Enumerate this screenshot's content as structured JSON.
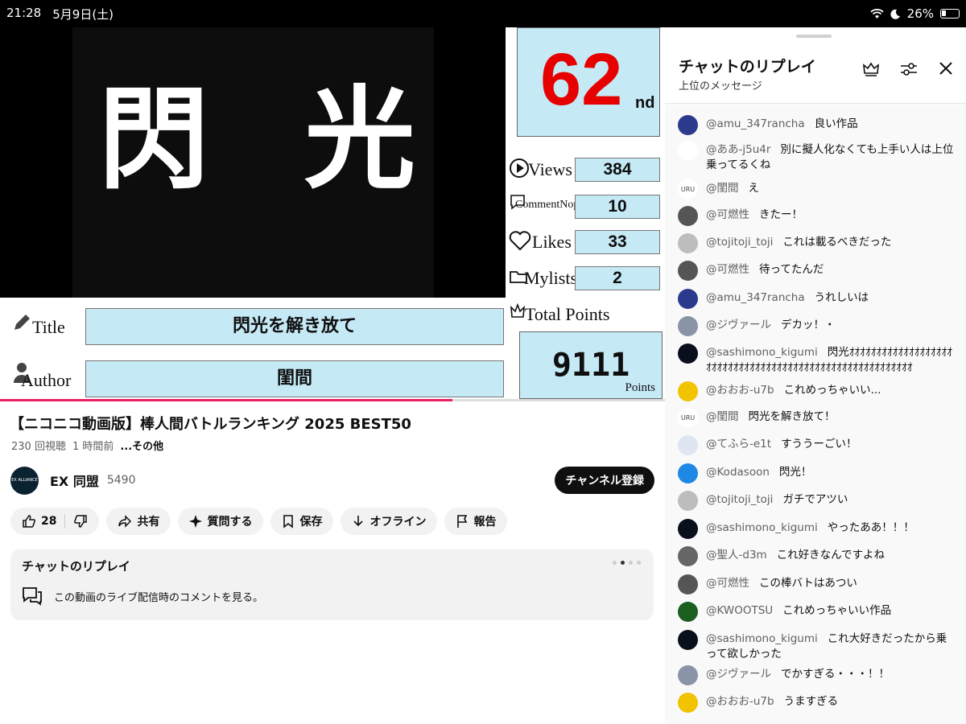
{
  "status_bar": {
    "time": "21:28",
    "date": "5月9日(土)",
    "battery": "26%"
  },
  "video": {
    "kanji_left": "閃",
    "kanji_right": "光",
    "rank_number": "62",
    "rank_suffix": "nd",
    "stats": [
      {
        "label": "Views",
        "value": "384"
      },
      {
        "label": "CommentNop",
        "value": "10"
      },
      {
        "label": "Likes",
        "value": "33"
      },
      {
        "label": "Mylists",
        "value": "2"
      }
    ],
    "total_label": "Total Points",
    "total_value": "9111",
    "total_unit": "Points",
    "title_label": "Title",
    "title_value": "閃光を解き放て",
    "author_label": "Author",
    "author_value": "閨間",
    "progress_fraction": 0.68
  },
  "info": {
    "title": "【ニコニコ動画版】棒人間バトルランキング 2025 BEST50",
    "views": "230 回視聴",
    "age": "1 時間前",
    "more": "...その他",
    "channel_name": "EX 同盟",
    "channel_subs": "5490",
    "avatar_text": "EX ALLIANCE",
    "subscribe": "チャンネル登録",
    "like_count": "28",
    "share": "共有",
    "ask": "質問する",
    "save": "保存",
    "offline": "オフライン",
    "report": "報告",
    "replay_title": "チャットのリプレイ",
    "replay_desc": "この動画のライブ配信時のコメントを見る。"
  },
  "chat": {
    "title": "チャットのリプレイ",
    "subtitle": "上位のメッセージ",
    "messages": [
      {
        "user": "@amu_347rancha",
        "text": "良い作品",
        "avatar_color": "#2b3a8c"
      },
      {
        "user": "@ああ-j5u4r",
        "text": "別に擬人化なくても上手い人は上位乗ってるくね",
        "avatar_color": "#ffffff"
      },
      {
        "user": "@閨間",
        "text": "え",
        "avatar_color": "#ffffff",
        "avatar_text": "URU"
      },
      {
        "user": "@可燃性",
        "text": "きたー！",
        "avatar_color": "#555555"
      },
      {
        "user": "@tojitoji_toji",
        "text": "これは載るべきだった",
        "avatar_color": "#bdbdbd"
      },
      {
        "user": "@可燃性",
        "text": "待ってたんだ",
        "avatar_color": "#555555"
      },
      {
        "user": "@amu_347rancha",
        "text": "うれしいは",
        "avatar_color": "#2b3a8c"
      },
      {
        "user": "@ジヴァール",
        "text": "デカッ！・",
        "avatar_color": "#8a93a8"
      },
      {
        "user": "@sashimono_kigumi",
        "text": "閃光ｵｵｵｵｵｵｵｵｵｵｵｵｵｵｵｵｵｵｵｵｵｵｵｵｵｵｵｵｵｵｵｵｵｵｵｵｵｵｵｵｵｵｵｵｵｵｵｵｵｵｵｵｵｵｵｵｵ",
        "avatar_color": "#0a0f1e"
      },
      {
        "user": "@おおお-u7b",
        "text": "これめっちゃいい...",
        "avatar_color": "#f2c300"
      },
      {
        "user": "@閨間",
        "text": "閃光を解き放て！",
        "avatar_color": "#ffffff",
        "avatar_text": "URU"
      },
      {
        "user": "@てふら-e1t",
        "text": "すううーごい！",
        "avatar_color": "#dfe6f2"
      },
      {
        "user": "@Kodasoon",
        "text": "閃光！",
        "avatar_color": "#1e88e5"
      },
      {
        "user": "@tojitoji_toji",
        "text": "ガチでアツい",
        "avatar_color": "#bdbdbd"
      },
      {
        "user": "@sashimono_kigumi",
        "text": "やったああ！！！",
        "avatar_color": "#0a0f1e"
      },
      {
        "user": "@聖人-d3m",
        "text": "これ好きなんですよね",
        "avatar_color": "#666666"
      },
      {
        "user": "@可燃性",
        "text": "この棒バトはあつい",
        "avatar_color": "#555555"
      },
      {
        "user": "@KWOOTSU",
        "text": "これめっちゃいい作品",
        "avatar_color": "#1b5e20"
      },
      {
        "user": "@sashimono_kigumi",
        "text": "これ大好きだったから乗って欲しかった",
        "avatar_color": "#0a0f1e"
      },
      {
        "user": "@ジヴァール",
        "text": "でかすぎる・・・！！",
        "avatar_color": "#8a93a8"
      },
      {
        "user": "@おおお-u7b",
        "text": "うますぎる",
        "avatar_color": "#f2c300"
      }
    ]
  }
}
